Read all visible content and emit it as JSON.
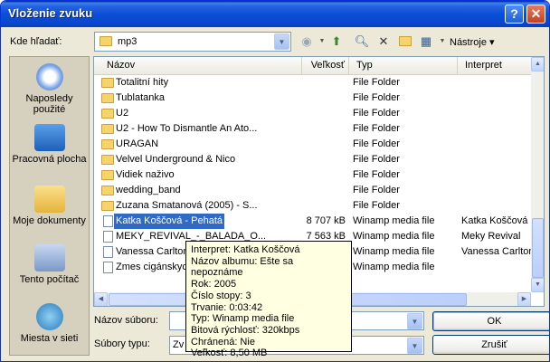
{
  "title": "Vloženie zvuku",
  "lookin": {
    "label": "Kde hľadať:",
    "value": "mp3"
  },
  "toolbar": {
    "tools_label": "Nástroje"
  },
  "places": [
    "Naposledy použité",
    "Pracovná plocha",
    "Moje dokumenty",
    "Tento počítač",
    "Miesta v sieti"
  ],
  "columns": {
    "name": "Názov",
    "size": "Veľkosť",
    "type": "Typ",
    "artist": "Interpret"
  },
  "files": [
    {
      "name": "Totalitní hity",
      "size": "",
      "type": "File Folder",
      "artist": ""
    },
    {
      "name": "Tublatanka",
      "size": "",
      "type": "File Folder",
      "artist": ""
    },
    {
      "name": "U2",
      "size": "",
      "type": "File Folder",
      "artist": ""
    },
    {
      "name": "U2 - How To Dismantle An Ato...",
      "size": "",
      "type": "File Folder",
      "artist": ""
    },
    {
      "name": "URAGAN",
      "size": "",
      "type": "File Folder",
      "artist": ""
    },
    {
      "name": "Velvel Underground & Nico",
      "size": "",
      "type": "File Folder",
      "artist": ""
    },
    {
      "name": "Vidiek naživo",
      "size": "",
      "type": "File Folder",
      "artist": ""
    },
    {
      "name": "wedding_band",
      "size": "",
      "type": "File Folder",
      "artist": ""
    },
    {
      "name": "Zuzana Smatanová (2005) - S...",
      "size": "",
      "type": "File Folder",
      "artist": ""
    },
    {
      "name": "Katka Koščová - Pehatá",
      "size": "8 707 kB",
      "type": "Winamp media file",
      "artist": "Katka Koščová"
    },
    {
      "name": "MEKY_REVIVAL_-_BALADA_O...",
      "size": "7 563 kB",
      "type": "Winamp media file",
      "artist": "Meky Revival"
    },
    {
      "name": "Vanessa Carlton",
      "size": "",
      "type": "Winamp media file",
      "artist": "Vanessa Carlton"
    },
    {
      "name": "Zmes cigánskych",
      "size": "",
      "type": "Winamp media file",
      "artist": ""
    }
  ],
  "tooltip": [
    "Interpret: Katka Koščová",
    "Názov albumu: Ešte sa nepoznáme",
    "Rok: 2005",
    "Číslo stopy: 3",
    "Trvanie: 0:03:42",
    "Typ: Winamp media file",
    "Bitová rýchlosť: 320kbps",
    "Chránená: Nie",
    "Veľkosť: 8,50 MB"
  ],
  "filename": {
    "label": "Názov súboru:",
    "value": ""
  },
  "filetype": {
    "label": "Súbory typu:",
    "value": "Zv"
  },
  "buttons": {
    "ok": "OK",
    "cancel": "Zrušiť"
  }
}
